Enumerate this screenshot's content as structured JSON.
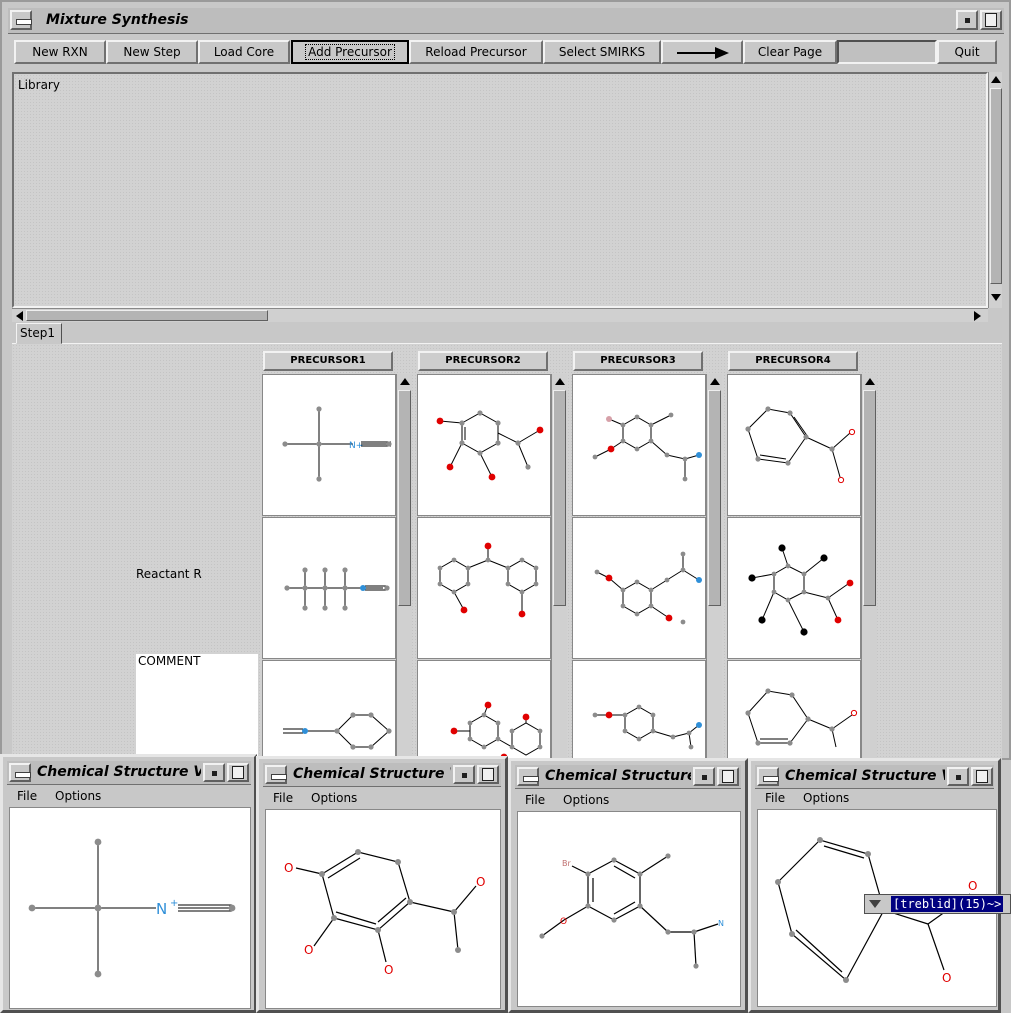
{
  "main_window": {
    "title": "Mixture Synthesis",
    "toolbar": {
      "new_rxn": "New RXN",
      "new_step": "New Step",
      "load_core": "Load Core",
      "add_precursor": "Add Precursor",
      "reload_precursor": "Reload Precursor",
      "select_smirks": "Select SMIRKS",
      "clear_page": "Clear Page",
      "quit": "Quit"
    },
    "library_label": "Library",
    "tab_step1": "Step1",
    "precursor_headers": [
      "PRECURSOR1",
      "PRECURSOR2",
      "PRECURSOR3",
      "PRECURSOR4"
    ],
    "reactant_label": "Reactant R",
    "comment_label": "COMMENT"
  },
  "viewers": [
    {
      "title": "Chemical Structure Vie",
      "menu_file": "File",
      "menu_options": "Options"
    },
    {
      "title": "Chemical Structure Vi",
      "menu_file": "File",
      "menu_options": "Options"
    },
    {
      "title": "Chemical Structure \\",
      "menu_file": "File",
      "menu_options": "Options"
    },
    {
      "title": "Chemical Structure Vie",
      "menu_file": "File",
      "menu_options": "Options"
    }
  ],
  "viewer_atom_labels": {
    "v1_n": "N",
    "v1_charge": "+",
    "v2_o": "O",
    "v3_br": "Br",
    "v3_o": "O",
    "v3_n": "N",
    "v4_o": "O"
  },
  "cell_atom_labels": {
    "p1_n": "N+"
  },
  "terminal_tag": "[treblid](15)~>",
  "colors": {
    "oxygen": "#e00000",
    "nitrogen": "#2f8fd8",
    "bromine": "#c07070",
    "atom": "#8c8c8c",
    "terminal_bg": "#000080"
  }
}
